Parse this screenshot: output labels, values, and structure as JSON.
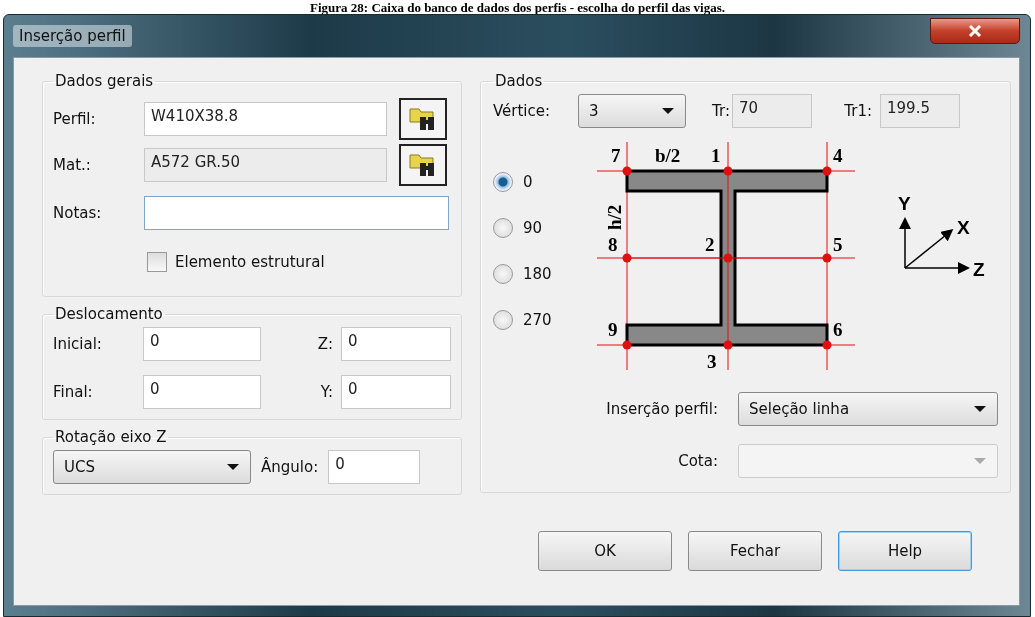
{
  "caption": "Figura 28: Caixa do banco de dados dos perfis - escolha do perfil das vigas.",
  "window": {
    "title": "Inserção perfil"
  },
  "general": {
    "title": "Dados gerais",
    "fields": [
      {
        "label": "Perfil:",
        "value": "W410X38.8",
        "readonly": false,
        "lookup": true
      },
      {
        "label": "Mat.:",
        "value": "A572 GR.50",
        "readonly": true,
        "lookup": true
      },
      {
        "label": "Notas:",
        "readonly": false,
        "lookup": false,
        "focused": true
      }
    ],
    "checkbox": {
      "label": "Elemento estrutural",
      "checked": false
    }
  },
  "offset": {
    "title": "Deslocamento",
    "fields": [
      {
        "label": "Inicial:",
        "value": "0"
      },
      {
        "label": "Z:",
        "value": "0"
      },
      {
        "label": "Final:",
        "value": "0"
      },
      {
        "label": "Y:",
        "value": "0"
      }
    ]
  },
  "rotation": {
    "title": "Rotação eixo Z",
    "select": {
      "value": "UCS"
    },
    "angle": {
      "label": "Ângulo:",
      "value": "0"
    }
  },
  "data": {
    "title": "Dados",
    "vertex": {
      "label": "Vértice:",
      "value": "3"
    },
    "tr": {
      "label": "Tr:",
      "value": "70"
    },
    "tr1": {
      "label": "Tr1:",
      "value": "199.5"
    },
    "radios": [
      {
        "label": "0",
        "selected": true
      },
      {
        "label": "90",
        "selected": false
      },
      {
        "label": "180",
        "selected": false
      },
      {
        "label": "270",
        "selected": false
      }
    ],
    "diagram": {
      "vertex_labels": [
        "7",
        "1",
        "4",
        "8",
        "2",
        "5",
        "9",
        "6",
        "3"
      ],
      "width_label": "b/2",
      "height_label": "h/2"
    },
    "axes": {
      "y": "Y",
      "x": "X",
      "z": "Z"
    },
    "insertion": {
      "label": "Inserção perfil:",
      "value": "Seleção linha",
      "disabled": false
    },
    "cota": {
      "label": "Cota:",
      "disabled": true
    }
  },
  "buttons": [
    {
      "label": "OK",
      "default": false
    },
    {
      "label": "Fechar",
      "default": false
    },
    {
      "label": "Help",
      "default": true
    }
  ]
}
